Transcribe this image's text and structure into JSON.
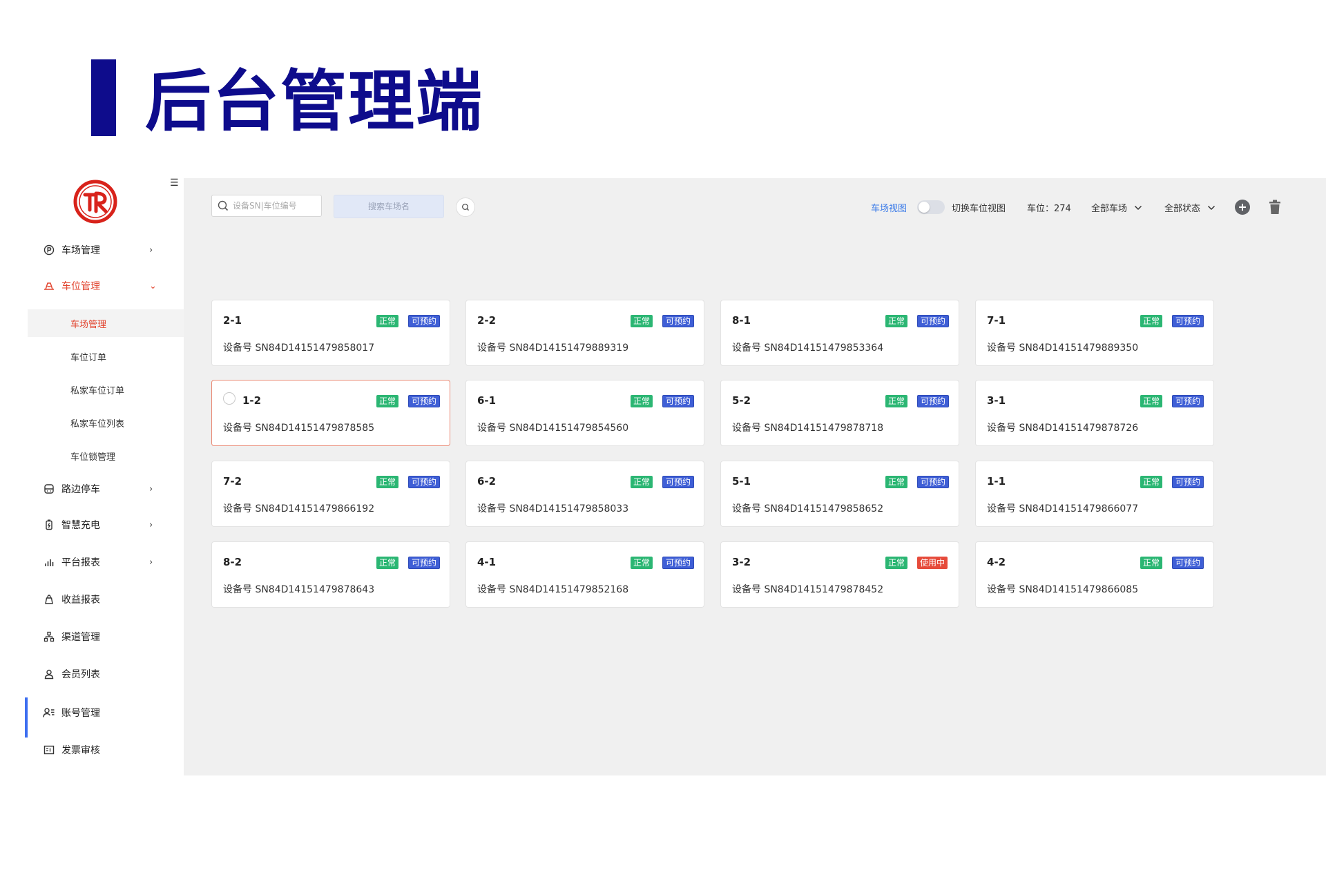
{
  "slide": {
    "title": "后台管理端"
  },
  "sidebar": {
    "items": [
      {
        "label": "车场管理",
        "icon": "parking-icon",
        "chev": "›"
      },
      {
        "label": "车位管理",
        "icon": "parking-space-icon",
        "chev": "⌄"
      },
      {
        "label": "路边停车",
        "icon": "roadside-parking-icon",
        "chev": "›"
      },
      {
        "label": "智慧充电",
        "icon": "charging-icon",
        "chev": "›"
      },
      {
        "label": "平台报表",
        "icon": "report-chart-icon",
        "chev": "›"
      },
      {
        "label": "收益报表",
        "icon": "revenue-icon",
        "chev": ""
      },
      {
        "label": "渠道管理",
        "icon": "channel-icon",
        "chev": ""
      },
      {
        "label": "会员列表",
        "icon": "member-icon",
        "chev": ""
      },
      {
        "label": "账号管理",
        "icon": "account-icon",
        "chev": ""
      },
      {
        "label": "发票审核",
        "icon": "invoice-icon",
        "chev": ""
      }
    ],
    "sub_items": [
      {
        "label": "车场管理"
      },
      {
        "label": "车位订单"
      },
      {
        "label": "私家车位订单"
      },
      {
        "label": "私家车位列表"
      },
      {
        "label": "车位锁管理"
      }
    ]
  },
  "toolbar": {
    "search_placeholder": "设备SN|车位编号",
    "name_placeholder": "搜索车场名",
    "view_link": "车场视图",
    "switch_label": "切换车位视图",
    "count_label": "车位：274",
    "lot_filter": "全部车场",
    "status_filter": "全部状态"
  },
  "device_prefix": "设备号",
  "cards": [
    {
      "name": "2-1",
      "status": "正常",
      "state": "可预约",
      "sn": "设备号 SN84D14151479858017"
    },
    {
      "name": "2-2",
      "status": "正常",
      "state": "可预约",
      "sn": "设备号 SN84D14151479889319"
    },
    {
      "name": "8-1",
      "status": "正常",
      "state": "可预约",
      "sn": "设备号 SN84D14151479853364"
    },
    {
      "name": "7-1",
      "status": "正常",
      "state": "可预约",
      "sn": "设备号 SN84D14151479889350"
    },
    {
      "name": "1-2",
      "status": "正常",
      "state": "可预约",
      "sn": "设备号 SN84D14151479878585"
    },
    {
      "name": "6-1",
      "status": "正常",
      "state": "可预约",
      "sn": "设备号 SN84D14151479854560"
    },
    {
      "name": "5-2",
      "status": "正常",
      "state": "可预约",
      "sn": "设备号 SN84D14151479878718"
    },
    {
      "name": "3-1",
      "status": "正常",
      "state": "可预约",
      "sn": "设备号 SN84D14151479878726"
    },
    {
      "name": "7-2",
      "status": "正常",
      "state": "可预约",
      "sn": "设备号 SN84D14151479866192"
    },
    {
      "name": "6-2",
      "status": "正常",
      "state": "可预约",
      "sn": "设备号 SN84D14151479858033"
    },
    {
      "name": "5-1",
      "status": "正常",
      "state": "可预约",
      "sn": "设备号 SN84D14151479858652"
    },
    {
      "name": "1-1",
      "status": "正常",
      "state": "可预约",
      "sn": "设备号 SN84D14151479866077"
    },
    {
      "name": "8-2",
      "status": "正常",
      "state": "可预约",
      "sn": "设备号 SN84D14151479878643"
    },
    {
      "name": "4-1",
      "status": "正常",
      "state": "可预约",
      "sn": "设备号 SN84D14151479852168"
    },
    {
      "name": "3-2",
      "status": "正常",
      "state": "使用中",
      "sn": "设备号 SN84D14151479878452"
    },
    {
      "name": "4-2",
      "status": "正常",
      "state": "可预约",
      "sn": "设备号 SN84D14151479866085"
    }
  ],
  "colors": {
    "brand_title": "#0e0c8c",
    "active_nav": "#e2452f",
    "ok_badge": "#2bb673",
    "reserve_badge": "#3f5fd6",
    "in_use_badge": "#e64b3b",
    "link": "#3b7be8"
  }
}
